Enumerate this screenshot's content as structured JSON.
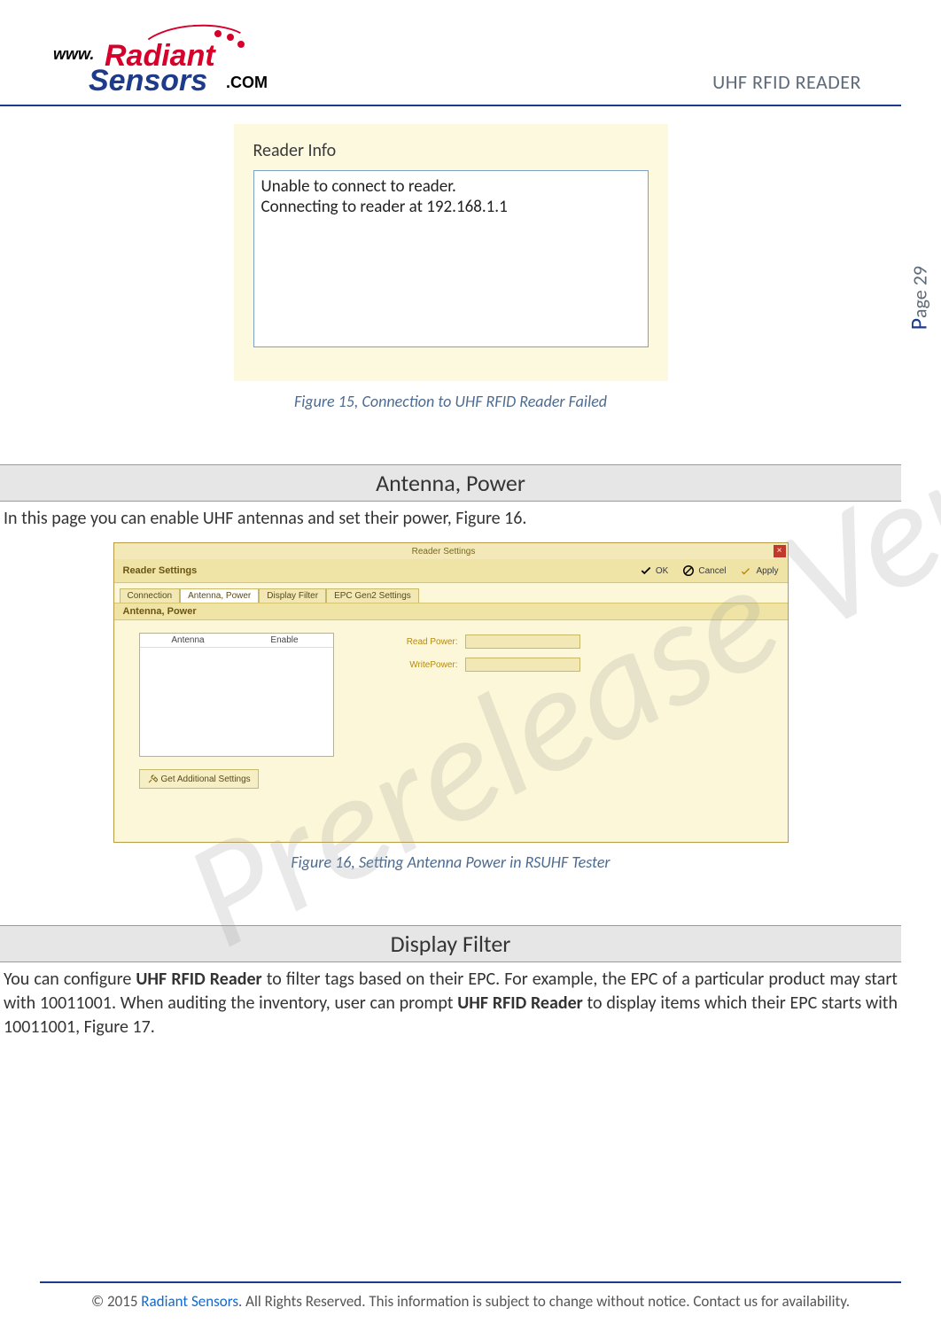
{
  "header": {
    "logo": {
      "www": "www.",
      "brand1": "Radiant",
      "brand2": "Sensors",
      "tld": ".COM"
    },
    "doc_title": "UHF RFID READER"
  },
  "watermark": "Prerelease Version",
  "page_number": {
    "prefix": "P",
    "rest": "age 29"
  },
  "figure15": {
    "box_title": "Reader Info",
    "line1": "Unable to connect to reader.",
    "line2": "Connecting to reader at 192.168.1.1",
    "caption": "Figure 15, Connection to UHF RFID Reader Failed"
  },
  "antenna_section": {
    "heading": "Antenna, Power",
    "intro": "In this page you can enable UHF antennas and set their power, Figure 16."
  },
  "figure16": {
    "dialog_title": "Reader Settings",
    "subtitle": "Reader Settings",
    "ok": "OK",
    "cancel": "Cancel",
    "apply": "Apply",
    "tabs": [
      "Connection",
      "Antenna, Power",
      "Display Filter",
      "EPC Gen2 Settings"
    ],
    "active_tab_index": 1,
    "section_sub": "Antenna, Power",
    "list_cols": [
      "Antenna",
      "Enable"
    ],
    "read_power_label": "Read Power:",
    "write_power_label": "WritePower:",
    "get_additional": "Get Additional Settings",
    "caption": "Figure 16, Setting Antenna Power in RSUHF Tester"
  },
  "display_filter_section": {
    "heading": "Display Filter",
    "para_pre": "You can configure ",
    "para_bold1": "UHF RFID Reader",
    "para_mid": " to filter tags based on their EPC. For example, the EPC of a particular product may start with 10011001. When auditing the inventory, user can prompt ",
    "para_bold2": "UHF RFID Reader",
    "para_post": " to display items which their EPC starts with 10011001, Figure 17."
  },
  "footer": {
    "pre": "© 2015 ",
    "brand": "Radiant Sensors",
    "post": ". All Rights Reserved. This information is subject to change without notice. Contact us for availability."
  }
}
